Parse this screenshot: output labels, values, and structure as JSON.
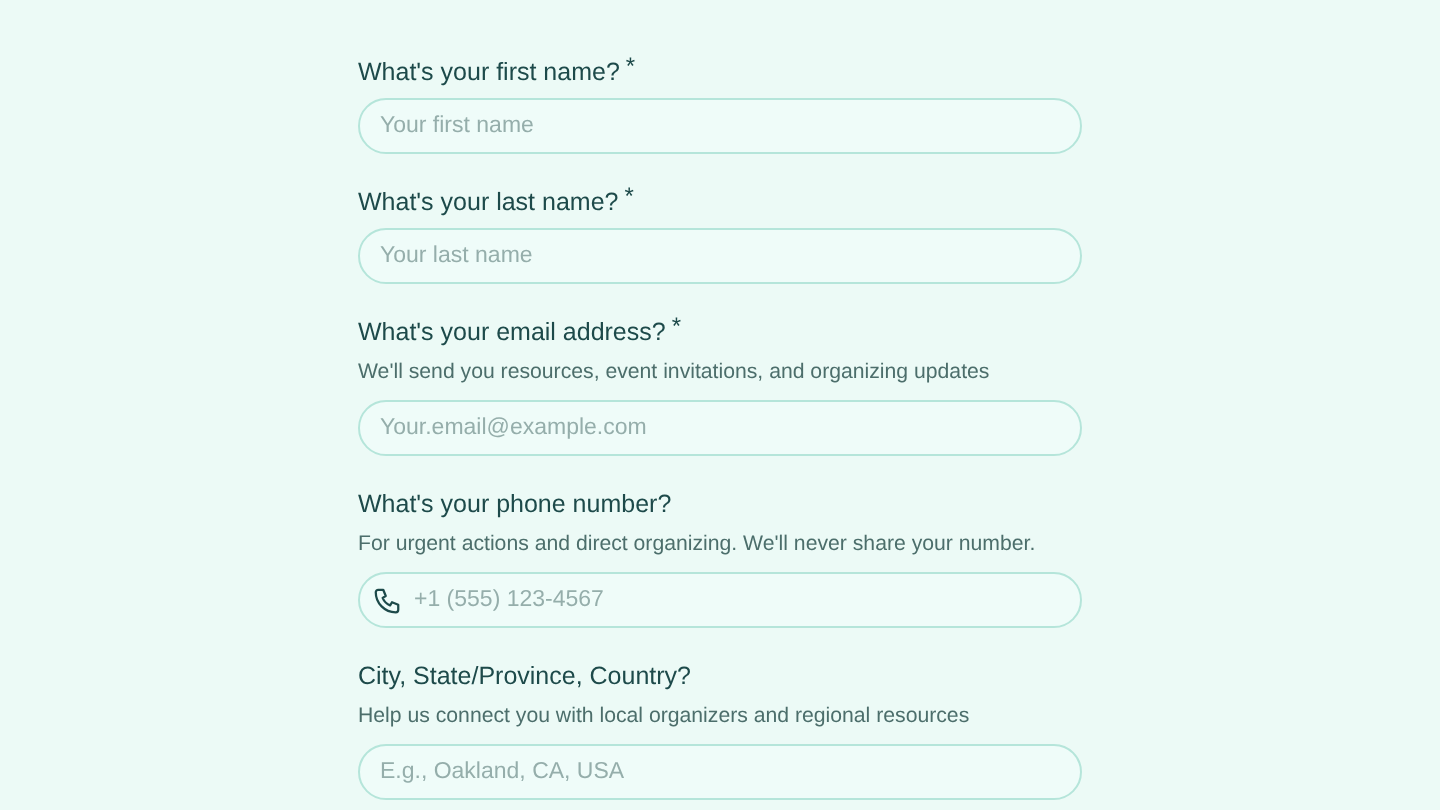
{
  "fields": [
    {
      "kind": "text",
      "label": "What's your first name?",
      "required_mark": "*",
      "placeholder": "Your first name"
    },
    {
      "kind": "text",
      "label": "What's your last name?",
      "required_mark": "*",
      "placeholder": "Your last name"
    },
    {
      "kind": "text",
      "label": "What's your email address?",
      "required_mark": "*",
      "help": "We'll send you resources, event invitations, and organizing updates",
      "placeholder": "Your.email@example.com"
    },
    {
      "kind": "phone",
      "label": "What's your phone number?",
      "help": "For urgent actions and direct organizing. We'll never share your number.",
      "placeholder": "+1 (555) 123-4567"
    },
    {
      "kind": "text",
      "label": "City, State/Province, Country?",
      "help": "Help us connect you with local organizers and regional resources",
      "placeholder": "E.g., Oakland, CA, USA"
    }
  ]
}
